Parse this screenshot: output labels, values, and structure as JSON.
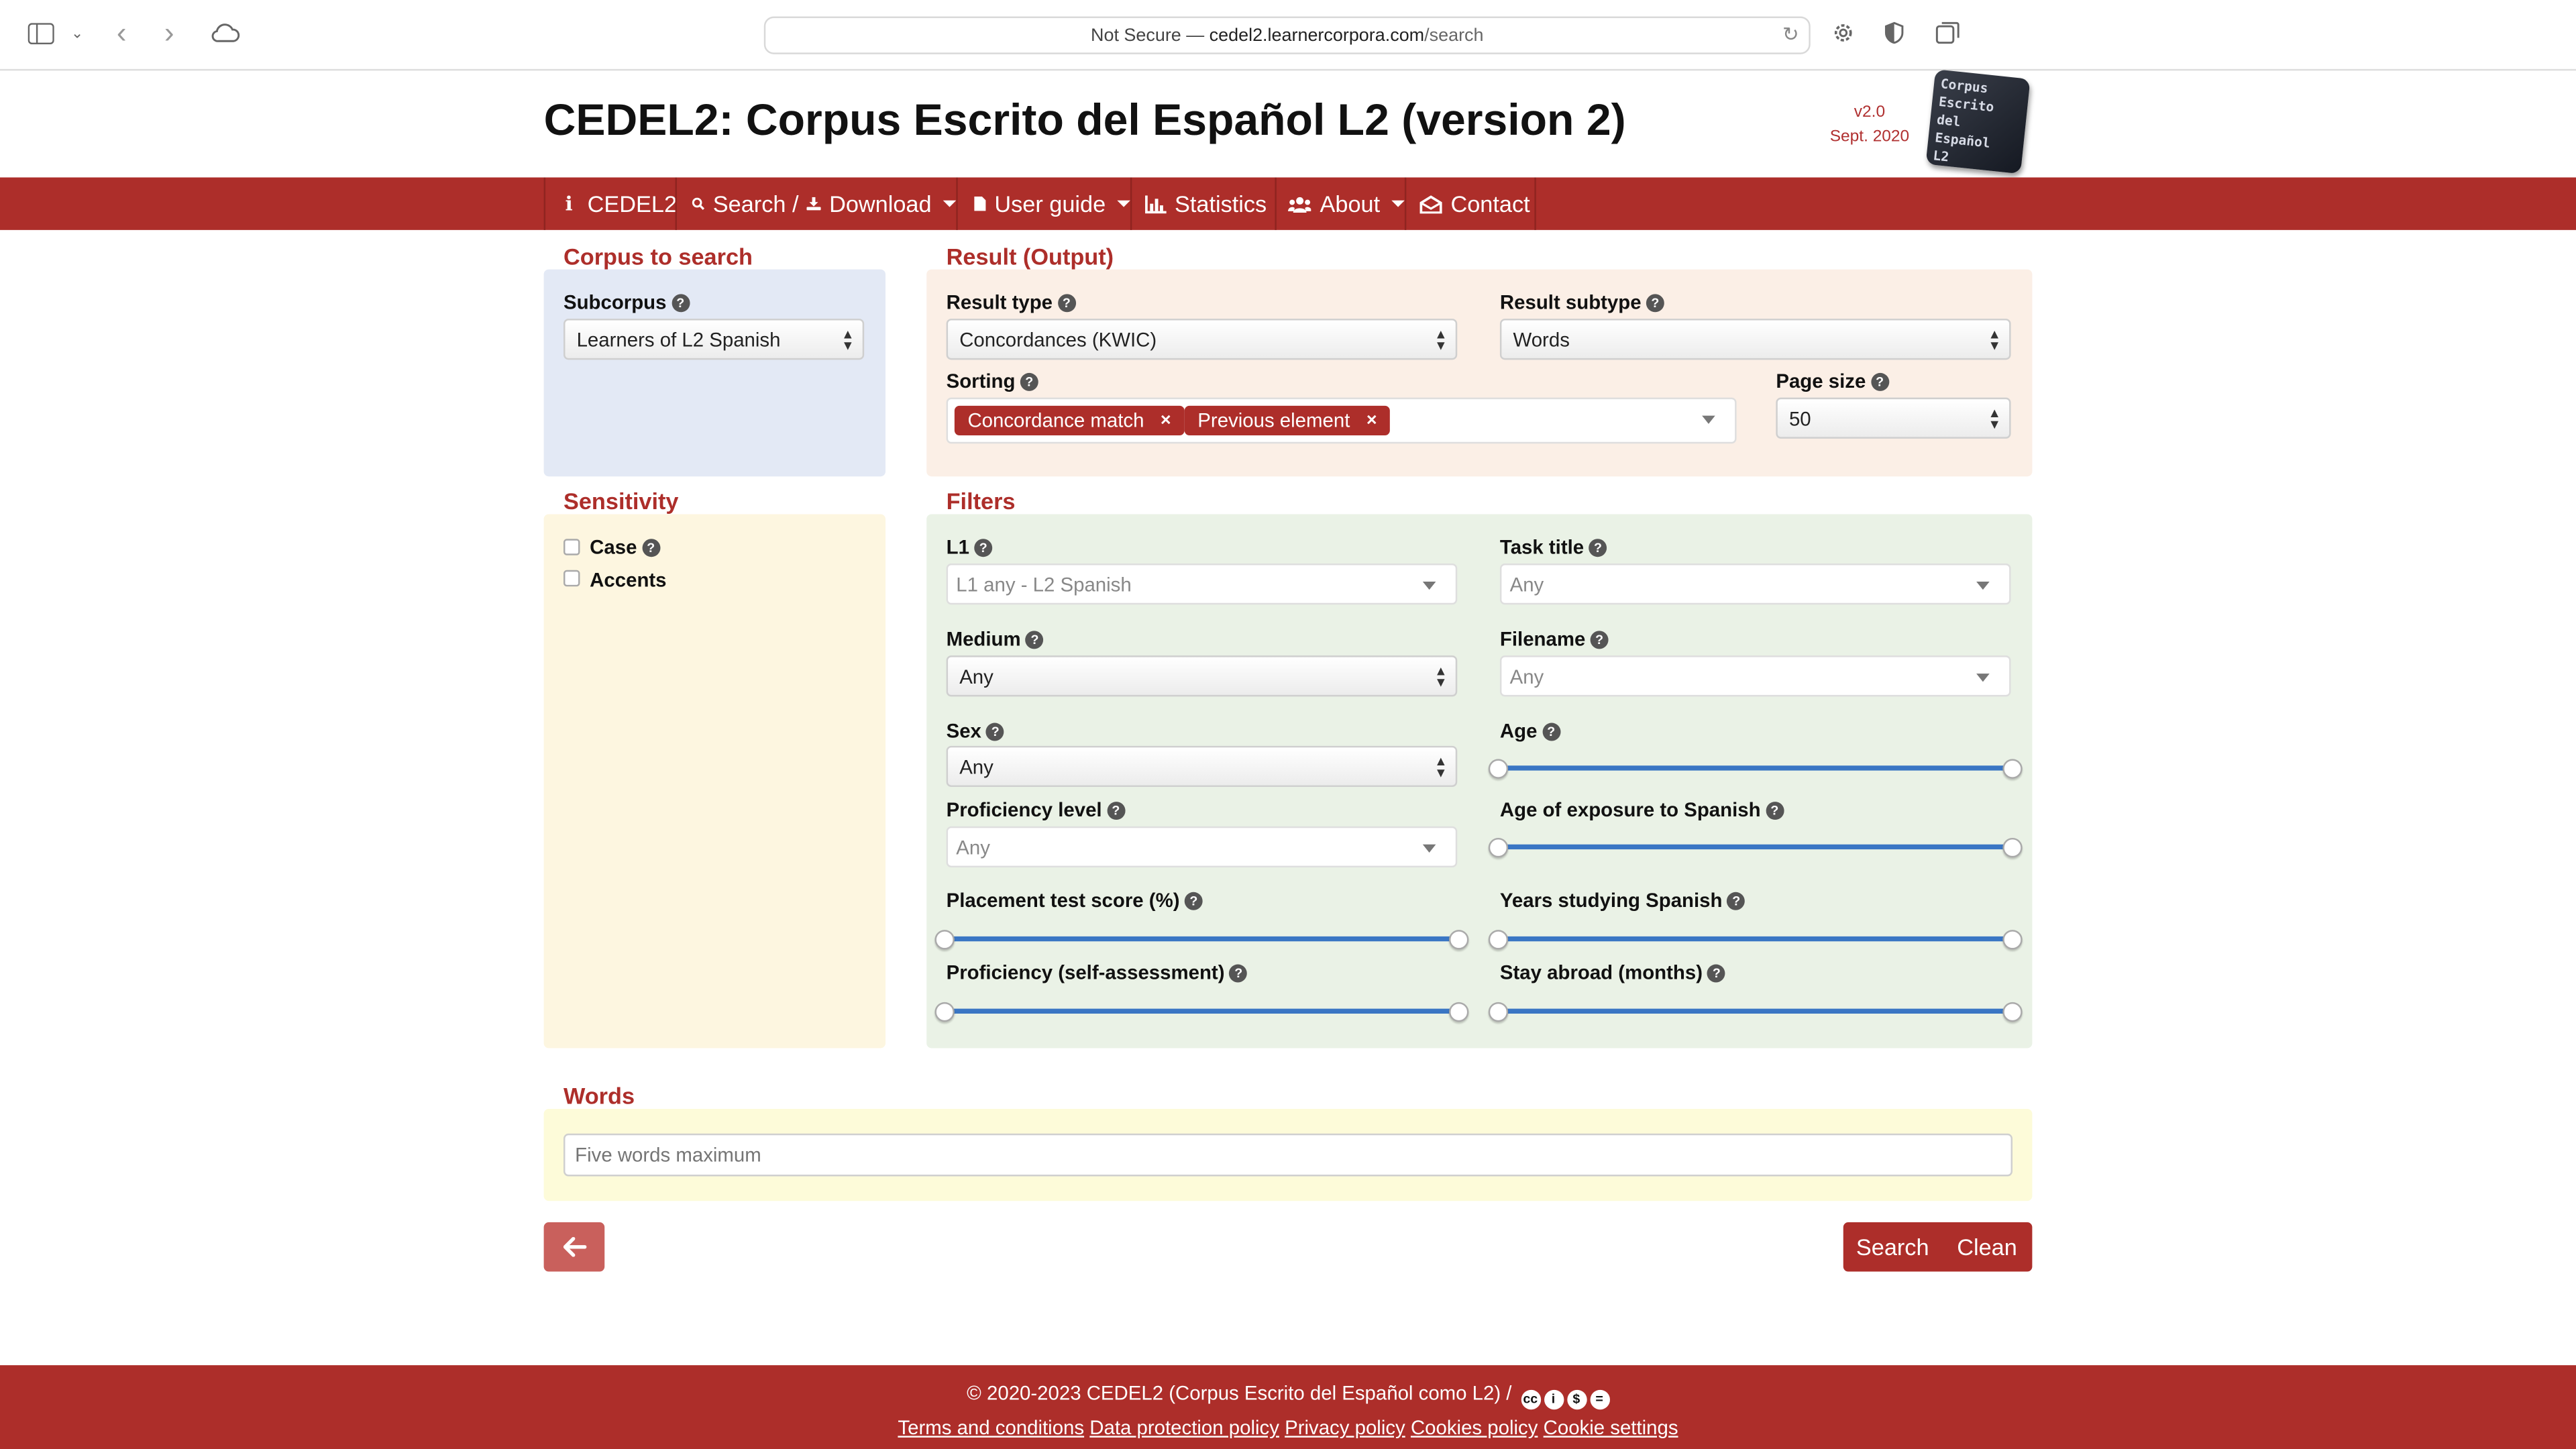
{
  "browser": {
    "url_prefix": "Not Secure — ",
    "url_host": "cedel2.learnercorpora.com",
    "url_path": "/search"
  },
  "header": {
    "title": "CEDEL2: Corpus Escrito del Español L2 (version 2)",
    "version": "v2.0",
    "version_date": "Sept. 2020",
    "logo_text": [
      "Corpus",
      "Escrito",
      "del",
      "Español",
      "L2"
    ]
  },
  "nav": {
    "cedel2": "CEDEL2",
    "search": "Search /",
    "download": "Download",
    "user_guide": "User guide",
    "statistics": "Statistics",
    "about": "About",
    "contact": "Contact"
  },
  "corpus": {
    "title": "Corpus to search",
    "subcorpus_label": "Subcorpus",
    "subcorpus_value": "Learners of L2 Spanish"
  },
  "result": {
    "title": "Result (Output)",
    "type_label": "Result type",
    "type_value": "Concordances (KWIC)",
    "subtype_label": "Result subtype",
    "subtype_value": "Words",
    "sorting_label": "Sorting",
    "sorting_tags": [
      "Concordance match",
      "Previous element"
    ],
    "page_size_label": "Page size",
    "page_size_value": "50"
  },
  "sensitivity": {
    "title": "Sensitivity",
    "case_label": "Case",
    "accents_label": "Accents"
  },
  "filters": {
    "title": "Filters",
    "l1_label": "L1",
    "l1_placeholder": "L1 any - L2 Spanish",
    "task_label": "Task title",
    "task_placeholder": "Any",
    "medium_label": "Medium",
    "medium_value": "Any",
    "filename_label": "Filename",
    "filename_placeholder": "Any",
    "sex_label": "Sex",
    "sex_value": "Any",
    "age_label": "Age",
    "proficiency_label": "Proficiency level",
    "proficiency_placeholder": "Any",
    "exposure_label": "Age of exposure to Spanish",
    "placement_label": "Placement test score (%)",
    "years_label": "Years studying Spanish",
    "selfassess_label": "Proficiency (self-assessment)",
    "abroad_label": "Stay abroad (months)"
  },
  "words": {
    "title": "Words",
    "placeholder": "Five words maximum"
  },
  "actions": {
    "search": "Search",
    "clean": "Clean"
  },
  "footer": {
    "copyright": "© 2020-2023 CEDEL2 (Corpus Escrito del Español como L2) /",
    "links": [
      "Terms and conditions",
      "Data protection policy",
      "Privacy policy",
      "Cookies policy",
      "Cookie settings"
    ]
  },
  "colors": {
    "brand_red": "#ad2e2a",
    "slider_blue": "#3a76c4",
    "corpus_panel_bg": "#e3e9f5",
    "result_panel_bg": "#fbefe6",
    "sensitivity_panel_bg": "#fdf6e0",
    "filters_panel_bg": "#eaf2e6",
    "words_panel_bg": "#fdfbd9"
  }
}
